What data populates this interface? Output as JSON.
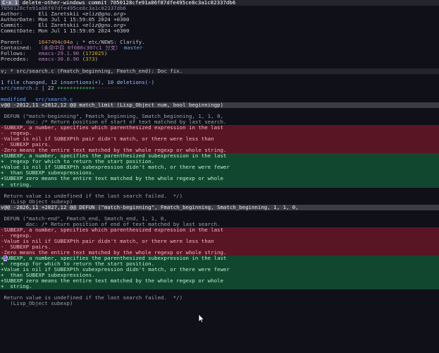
{
  "title_bar": {
    "badge": "C-x 1",
    "text": " delete-other-windows commit 7050128cfe91a86f87dfe495ce8c3a1c82337db6"
  },
  "commit": {
    "hash_line": "7050128cfe91a86f87dfe495ce8c3a1c82337db6",
    "author_label": "Author:     ",
    "author": "Eli Zaretskii ",
    "author_email": "<eliz@gnu.org>",
    "authordate_label": "AuthorDate: ",
    "authordate": "Mon Jul 1 15:59:05 2024 +0300",
    "committer_label": "Commit:     ",
    "committer": "Eli Zaretskii ",
    "committer_email": "<eliz@gnu.org>",
    "commitdate_label": "CommitDate: ",
    "commitdate": "Mon Jul 1 15:59:05 2024 +0300",
    "parent_label": "Parent:     ",
    "parent_sha": "1647494c04a",
    "parent_msg": " ; * etc/NEWS: Clarify.",
    "contained_label": "Contained:  ",
    "contained_tags": "（未命中自 0f086c307c1 分支）",
    "contained_branch": " master",
    "follows_label": "Follows:    ",
    "follows_tag": "emacs-29.1.90",
    "follows_open": " (",
    "follows_count": "172025",
    "follows_close": ")",
    "precedes_label": "Precedes:   ",
    "precedes_tag": "emacs-30.0.90",
    "precedes_open": " (",
    "precedes_count": "373",
    "precedes_close": ")"
  },
  "message_header": "; * src/search.c (Fmatch_beginning, Fmatch_end): Doc fix.",
  "stats": {
    "summary": "1 file changed, 12 insertions(+), 10 deletions(-)",
    "file": "src/search.c",
    "sep": " | 22 ",
    "plusses": "++++++++++++",
    "minuses": "----------"
  },
  "diff": {
    "modified_label": "modified   ",
    "file": "src/search.c",
    "hunks": [
      {
        "header": "@@ -2812,11 +2812,12 @@ match_limit (Lisp_Object num, bool beginningp)",
        "lines": [
          {
            "type": "ctx",
            "text": ""
          },
          {
            "type": "ctx",
            "text": " DEFUN (\"match-beginning\", Fmatch_beginning, Smatch_beginning, 1, 1, 0,"
          },
          {
            "type": "ctx",
            "text": "        doc: /* Return position of start of text matched by last search."
          },
          {
            "type": "del",
            "text": "-SUBEXP, a number, specifies which parenthesized expression in the last"
          },
          {
            "type": "del",
            "text": "-  regexp."
          },
          {
            "type": "del",
            "text": "-Value is nil if SUBEXPth pair didn't match, or there were less than"
          },
          {
            "type": "del",
            "text": "-  SUBEXP pairs."
          },
          {
            "type": "del",
            "text": "-Zero means the entire text matched by the whole regexp or whole string."
          },
          {
            "type": "add",
            "text": "+SUBEXP, a number, specifies the parenthesized subexpression in the last"
          },
          {
            "type": "add",
            "text": "+  regexp for which to return the start position."
          },
          {
            "type": "add",
            "text": "+Value is nil if SUBEXPth subexpression didn't match, or there were fewer"
          },
          {
            "type": "add",
            "text": "+  than SUBEXP subexpressions."
          },
          {
            "type": "add",
            "text": "+SUBEXP zero means the entire text matched by the whole regexp or whole"
          },
          {
            "type": "add",
            "text": "+  string."
          },
          {
            "type": "ctx",
            "text": ""
          },
          {
            "type": "ctx",
            "text": " Return value is undefined if the last search failed.  */)"
          },
          {
            "type": "ctx",
            "text": "   (Lisp_Object subexp)"
          }
        ]
      },
      {
        "header": "@@ -2826,11 +2827,12 @@ DEFUN (\"match-beginning\", Fmatch_beginning, Smatch_beginning, 1, 1, 0,",
        "lines": [
          {
            "type": "ctx",
            "text": ""
          },
          {
            "type": "ctx",
            "text": " DEFUN (\"match-end\", Fmatch_end, Smatch_end, 1, 1, 0,"
          },
          {
            "type": "ctx",
            "text": "        doc: /* Return position of end of text matched by last search."
          },
          {
            "type": "del",
            "text": "-SUBEXP, a number, specifies which parenthesized expression in the last"
          },
          {
            "type": "del",
            "text": "-  regexp."
          },
          {
            "type": "del",
            "text": "-Value is nil if SUBEXPth pair didn't match, or there were less than"
          },
          {
            "type": "del",
            "text": "-  SUBEXP pairs."
          },
          {
            "type": "del",
            "text": "-Zero means the entire text matched by the whole regexp or whole string."
          },
          {
            "type": "add",
            "text": "+SUBEXP, a number, specifies the parenthesized subexpression in the last",
            "cursor": true
          },
          {
            "type": "add",
            "text": "+  regexp for which to return the start position."
          },
          {
            "type": "add",
            "text": "+Value is nil if SUBEXPth subexpression didn't match, or there were fewer"
          },
          {
            "type": "add",
            "text": "+  than SUBEXP subexpressions."
          },
          {
            "type": "add",
            "text": "+SUBEXP zero means the entire text matched by the whole regexp or whole"
          },
          {
            "type": "add",
            "text": "+  string."
          },
          {
            "type": "ctx",
            "text": ""
          },
          {
            "type": "ctx",
            "text": " Return value is undefined if the last search failed.  */)"
          },
          {
            "type": "ctx",
            "text": "   (Lisp_Object subexp)"
          }
        ]
      }
    ]
  },
  "icons": {
    "mouse": "mouse-pointer-icon"
  }
}
